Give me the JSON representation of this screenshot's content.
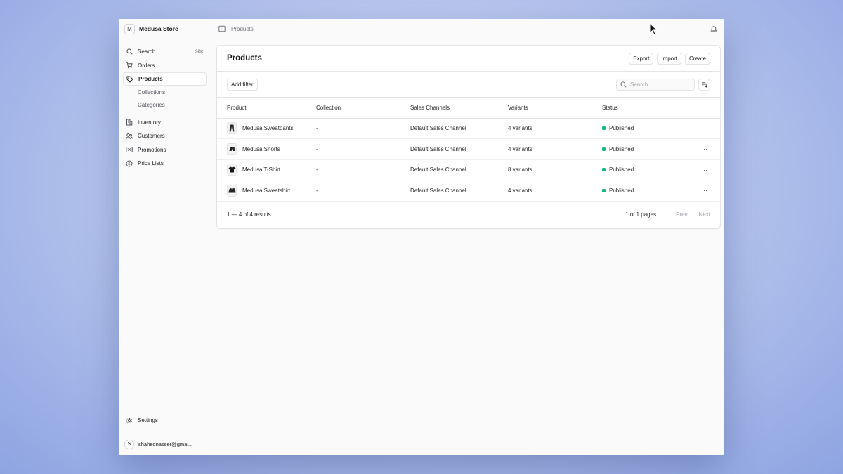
{
  "store": {
    "avatar": "M",
    "name": "Medusa Store",
    "more": "···"
  },
  "sidebar": {
    "search": {
      "label": "Search",
      "shortcut": "⌘K",
      "icon": "search-icon"
    },
    "items": [
      {
        "label": "Orders",
        "icon": "cart-icon"
      },
      {
        "label": "Products",
        "icon": "tag-icon",
        "active": true
      },
      {
        "label": "Inventory",
        "icon": "building-icon"
      },
      {
        "label": "Customers",
        "icon": "users-icon"
      },
      {
        "label": "Promotions",
        "icon": "receipt-icon"
      },
      {
        "label": "Price Lists",
        "icon": "currency-icon"
      }
    ],
    "sub_items": [
      "Collections",
      "Categories"
    ],
    "settings": "Settings",
    "user": {
      "avatar": "S",
      "email": "shahednasser@gmai...",
      "more": "···"
    }
  },
  "topbar": {
    "breadcrumb": "Products"
  },
  "page": {
    "title": "Products",
    "actions": {
      "export": "Export",
      "import": "Import",
      "create": "Create"
    },
    "add_filter": "Add filter",
    "search_placeholder": "Search"
  },
  "table": {
    "columns": [
      "Product",
      "Collection",
      "Sales Channels",
      "Variants",
      "Status"
    ],
    "rows": [
      {
        "product": "Medusa Sweatpants",
        "collection": "-",
        "channel": "Default Sales Channel",
        "variants": "4 variants",
        "status": "Published",
        "thumb": "pants"
      },
      {
        "product": "Medusa Shorts",
        "collection": "-",
        "channel": "Default Sales Channel",
        "variants": "4 variants",
        "status": "Published",
        "thumb": "shorts"
      },
      {
        "product": "Medusa T-Shirt",
        "collection": "-",
        "channel": "Default Sales Channel",
        "variants": "8 variants",
        "status": "Published",
        "thumb": "tshirt"
      },
      {
        "product": "Medusa Sweatshirt",
        "collection": "-",
        "channel": "Default Sales Channel",
        "variants": "4 variants",
        "status": "Published",
        "thumb": "sweatshirt"
      }
    ],
    "row_more": "···"
  },
  "pagination": {
    "summary": "1 — 4 of 4 results",
    "pages": "1 of 1 pages",
    "prev": "Prev",
    "next": "Next"
  },
  "colors": {
    "published": "#10b981",
    "border": "#e4e4e7"
  }
}
